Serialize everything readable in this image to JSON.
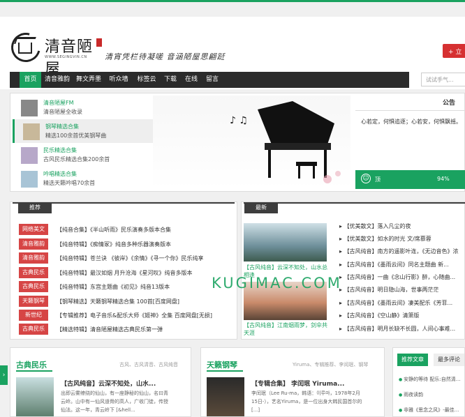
{
  "brand": {
    "site_name": "清音陋屋",
    "site_url": "WWW.SEGINGVIN.CN",
    "slogan": "清宵凭栏待凝嗟  音涵陋屋思翩跹",
    "register_label": "+ 立"
  },
  "nav": {
    "items": [
      "首页",
      "清音雅韵",
      "舞文弄墨",
      "听众墙",
      "标签云",
      "下载",
      "在线",
      "留言"
    ],
    "active_index": 0,
    "search_placeholder": "试试手气..."
  },
  "featured": [
    {
      "title": "清音陋屋FM",
      "subtitle": "清音陋屋全收录"
    },
    {
      "title": "钢琴精选合集",
      "subtitle": "精选100余首优美钢琴曲"
    },
    {
      "title": "民乐精选合集",
      "subtitle": "古风民乐精选合集200余首"
    },
    {
      "title": "吟唱精选合集",
      "subtitle": "精选天籁吟唱70余首"
    }
  ],
  "notice": {
    "heading": "公告",
    "text": "心若定，何惧追逐；心若安，何惧飘摇。",
    "top_label": "顶",
    "progress_label": "94%"
  },
  "recommend": {
    "heading": "推荐",
    "items": [
      {
        "tag": "网络美文",
        "text": "【纯音合集】《半山听雨》民乐演奏多版本合集"
      },
      {
        "tag": "清音雅韵",
        "text": "【纯音特辑】《痴情冢》纯音多种乐器演奏版本"
      },
      {
        "tag": "清音雅韵",
        "text": "【纯音特辑】苍兰诀 《彼岸》《余情》《寻一个你》民乐纯享"
      },
      {
        "tag": "古典民乐",
        "text": "【纯音特辑】最汉如烟 月升沧海《星河叹》纯音多版本"
      },
      {
        "tag": "古典民乐",
        "text": "【纯音特辑】东宫主题曲《初见》纯音13版本"
      },
      {
        "tag": "天籁钢琴",
        "text": "【钢琴精选】天籁钢琴精选合集 100首[百度网盘]"
      },
      {
        "tag": "新世纪",
        "text": "【专辑推荐】电子音乐&配乐大师《姬神》全集 百度网盘[无损]"
      },
      {
        "tag": "古典民乐",
        "text": "【精选特辑】清音陋屋精选古典民乐第一弹"
      }
    ]
  },
  "latest": {
    "heading": "最新",
    "captions": [
      "【古风纯音】云深不知处，山水总相逢",
      "【古风纯音】江南烟雨梦，剑伞共天涯"
    ],
    "items": [
      "【优美散文】落入凡尘的夜",
      "【优美散文】如水的时光 文/席慕蓉",
      "【古风纯音】南方的遥影叶连，《无边音色》浓",
      "【古风纯音】《墨雨云间》同名主题曲 新...",
      "【古风纯音】一曲《念山行影》醉，心随曲...",
      "【古风纯音】明日隐山海，世事两茫茫",
      "【古风纯音】《墨雨云间》凄美配乐《芳菲...",
      "【古风纯音】《空山静》清箫版",
      "【古风纯音】明月长缺不长圆，人间心事难..."
    ]
  },
  "watermark": "KUGIMAC.COM",
  "categories": [
    {
      "title": "古典民乐",
      "tags": "古风、古风清音、古风纯音",
      "post_title": "【古风纯音】云深不知处，山水...",
      "post_desc": "出即云雾缭绕的仙山，有一座静秘的仙山，名曰青云岭。山中有一仙风道骨的高人，广收门徒，传授仙法。这一年，青云岭下 [&hell..."
    },
    {
      "title": "天籁钢琴",
      "tags": "Yiruma、专辑推荐、李闰珉、钢琴",
      "post_title": "【专辑合集】 李闰珉 Yiruma...",
      "post_desc": "李闰珉（Lee Ru-ma，韩语：이루마，1978年2月15日-），艺名Yiruma，是一位出身大韩民国首尔的 [...]"
    }
  ],
  "sidebar": {
    "tabs": [
      "推荐文章",
      "最多评论"
    ],
    "items": [
      "安静的等待 配乐:自然清...",
      "雨夜读韵",
      "非雅《思念之风》-最佳..."
    ]
  },
  "colors": {
    "accent": "#1aa260",
    "tag_red": "#d64545",
    "nav_dark": "#2b2b2b"
  }
}
